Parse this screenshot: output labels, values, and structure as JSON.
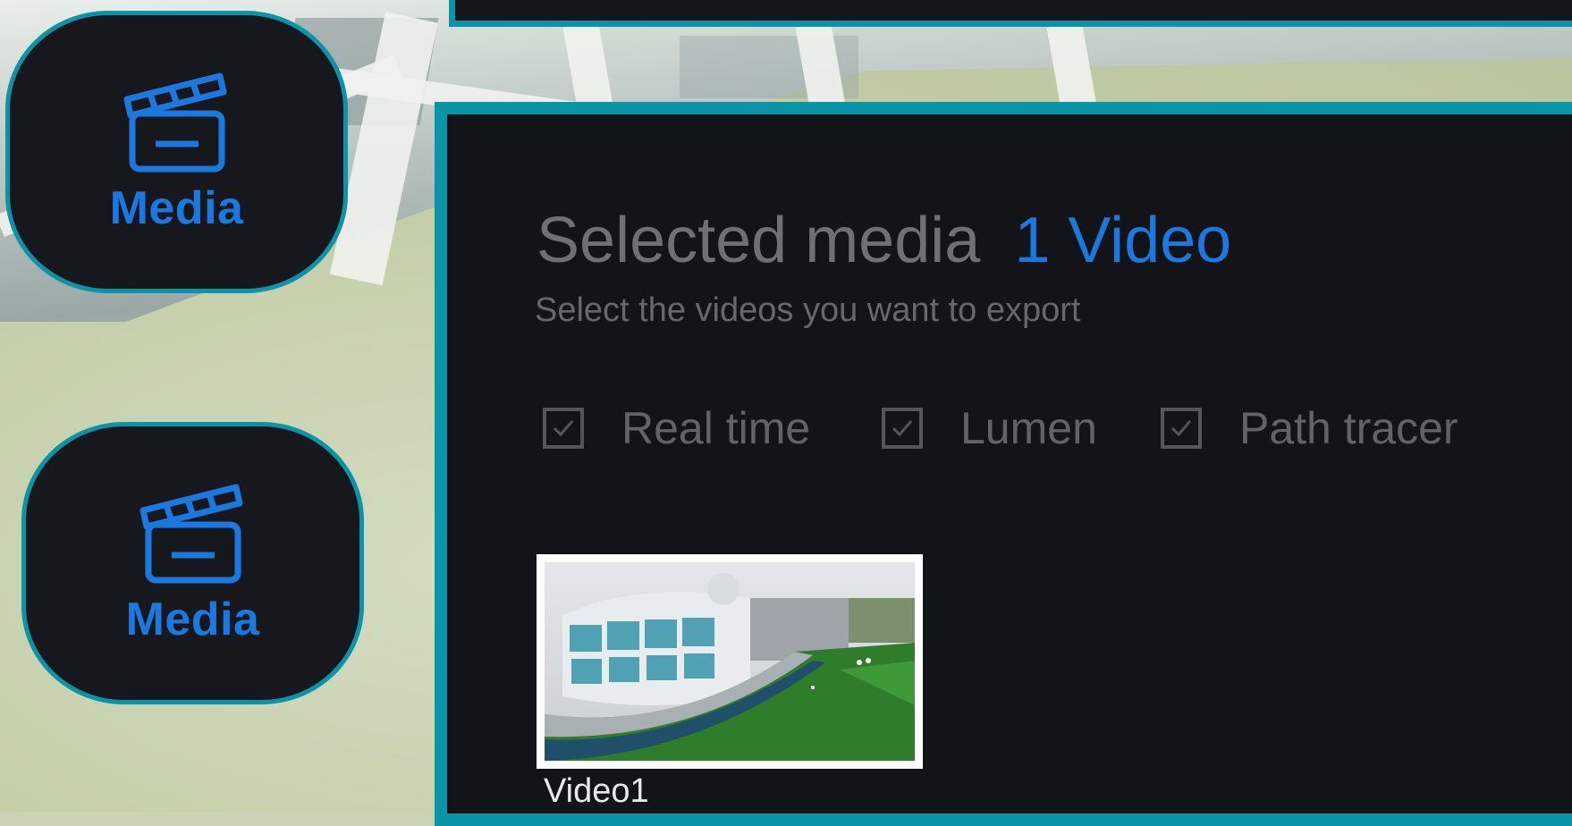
{
  "sidebar": {
    "buttons": [
      {
        "label": "Media",
        "icon": "clapperboard-icon"
      },
      {
        "label": "Media",
        "icon": "clapperboard-icon"
      }
    ]
  },
  "panel": {
    "title": "Selected media",
    "count_label": "1 Video",
    "subtitle": "Select the videos you want to export",
    "options": [
      {
        "label": "Real time",
        "checked": true
      },
      {
        "label": "Lumen",
        "checked": true
      },
      {
        "label": "Path tracer",
        "checked": true
      }
    ],
    "videos": [
      {
        "name": "Video1"
      }
    ]
  },
  "colors": {
    "accent": "#1a78de",
    "border": "#0b93a8",
    "panel_bg": "#131418",
    "muted_text": "#6f7075"
  }
}
